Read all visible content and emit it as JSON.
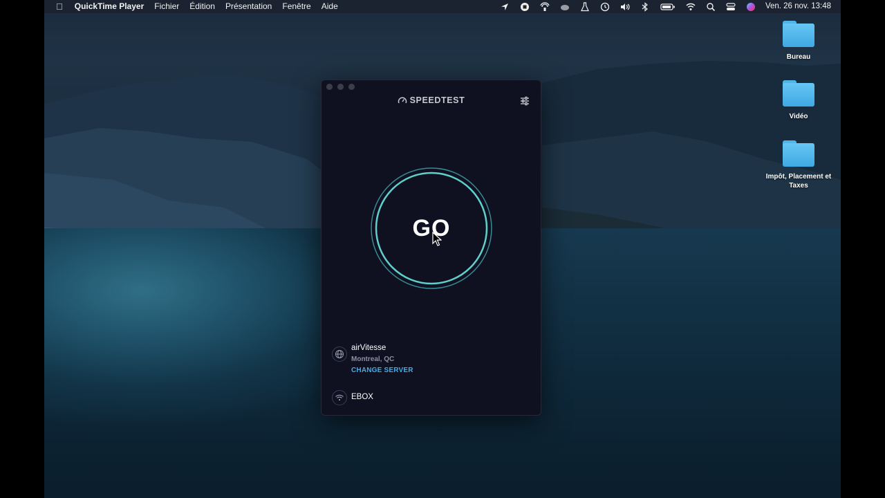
{
  "menubar": {
    "app_name": "QuickTime Player",
    "menus": [
      "Fichier",
      "Édition",
      "Présentation",
      "Fenêtre",
      "Aide"
    ],
    "clock": "Ven. 26 nov.  13:48",
    "status_icons": [
      "location-icon",
      "stop-recording-icon",
      "airdrop-icon",
      "cloud-icon",
      "flask-icon",
      "time-machine-icon",
      "volume-icon",
      "bluetooth-icon",
      "battery-icon",
      "wifi-icon",
      "search-icon",
      "control-center-icon",
      "siri-icon"
    ]
  },
  "desktop": {
    "folders": [
      {
        "label": "Bureau"
      },
      {
        "label": "Vidéo"
      },
      {
        "label": "Impôt, Placement et Taxes"
      }
    ]
  },
  "speedtest": {
    "logo": "SPEEDTEST",
    "go_label": "GO",
    "server": {
      "name": "airVitesse",
      "location": "Montreal, QC",
      "change_label": "CHANGE SERVER"
    },
    "isp": "EBOX",
    "colors": {
      "accent": "#4fc3c3",
      "link": "#4aa9e0",
      "background": "#0f1120"
    }
  }
}
